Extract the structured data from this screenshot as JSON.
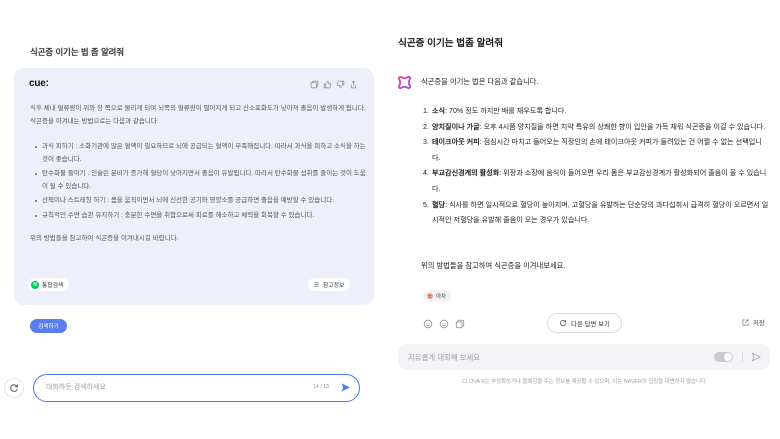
{
  "left": {
    "question": "식곤증 이기는 법 좀 알려줘",
    "answer": {
      "logo_text": "cue:",
      "action_icons": [
        "copy-icon",
        "thumbs-up-icon",
        "thumbs-down-icon",
        "share-icon"
      ],
      "intro": "식후 체내 혈류량이 위와 장 쪽으로 몰리게 되며 뇌쪽의 혈류량이 떨어지게 되고 산소포화도가 낮아져 졸음이 발생하게 됩니다. 식곤증을 이겨내는 방법으로는 다음과 같습니다.",
      "bullets": [
        "과식 피하기 : 소화기관에 많은 혈액이 필요하므로 뇌에 공급되는 혈액이 부족해집니다. 따라서 과식을 피하고 소식을 하는 것이 좋습니다.",
        "탄수화물 줄이기 : 인슐린 분비가 증가해 혈당이 낮아지면서 졸음이 유발됩니다. 따라서 탄수화물 섭취를 줄이는 것이 도움이 될 수 있습니다.",
        "산책이나 스트레칭 하기 : 몸을 움직이면서 뇌에 신선한 공기와 영양소를 공급하면 졸음을 예방할 수 있습니다.",
        "규칙적인 수면 습관 유지하기 : 충분한 수면을 취함으로써 피로를 해소하고 체력을 회복할 수 있습니다."
      ],
      "closing": "위의 방법들을 참고하여 식곤증을 이겨내시길 바랍니다.",
      "source_chip": {
        "logo_text": "N",
        "label": "통합검색",
        "icon": "naver-logo-icon"
      },
      "reference_chip": {
        "label": "참고정보",
        "icon": "list-icon"
      }
    },
    "search_button_label": "검색하기",
    "composer": {
      "refresh_icon": "refresh-icon",
      "placeholder": "대화하듯 검색하세요",
      "counter": "14 / 13",
      "send_icon": "send-icon"
    }
  },
  "right": {
    "question": "식곤증 이기는 법좀 알려줘",
    "answer": {
      "avatar_icon": "clova-x-logo-icon",
      "intro": "식곤증을 이기는 법은 다음과 같습니다.",
      "items": [
        {
          "number": "1.",
          "title": "소식",
          "text": ": 70% 정도 까지만 배를 채우도록 합니다."
        },
        {
          "number": "2.",
          "title": "양치질이나 가글",
          "text": ": 오후 4시쯤 양치질을 하면 치약 특유의 상쾌한 향이 입안을 가득 채워 식곤증을 이길 수 있습니다."
        },
        {
          "number": "3.",
          "title": "테이크아웃 커피",
          "text": ": 점심시간 마치고 들어오는 직장인의 손에 테이크아웃 커피가 들려있는 건 어쩔 수 없는 선택입니다."
        },
        {
          "number": "4.",
          "title": "부교감신경계의 활성화",
          "text": ": 위장과 소장에 음식이 들어오면 우리 몸은 부교감신경계가 활성화되어 졸음이 올 수 있습니다."
        },
        {
          "number": "5.",
          "title": "혈당",
          "text": ": 식사를 하면 일시적으로 혈당이 높아지며, 고혈당을 유발하는 단순당의 과다섭취시 급격히 혈당이 오르면서 일시적인 저혈당을 유발해 졸음이 오는 경우가 있습니다."
        }
      ],
      "closing": "위의 방법들을 참고하여 식곤증을 이겨내보세요.",
      "chip_label": "아차",
      "feedback_icons": [
        "smile-icon",
        "frown-icon",
        "copy-icon"
      ],
      "regenerate_label": "다른 답변 보기",
      "save_label": "저장"
    },
    "composer": {
      "placeholder": "자유롭게 대화해 보세요",
      "send_icon": "send-icon"
    },
    "disclaimer": "CLOVA X는 부정확하거나 불쾌감을 주는 정보를 제공할 수 있으며, 이는 NAVER의 입장을 대변하지 않습니다"
  },
  "colors": {
    "cue_accent": "#4b7bec",
    "cue_card_background": "#edf0fa",
    "cue_search_button": "#5a7ef0",
    "naver_green": "#03c75a",
    "clova_logo_gradient": [
      "#ff3d8b",
      "#8b5cf6"
    ],
    "clova_input_background": "#f4f4f6"
  }
}
